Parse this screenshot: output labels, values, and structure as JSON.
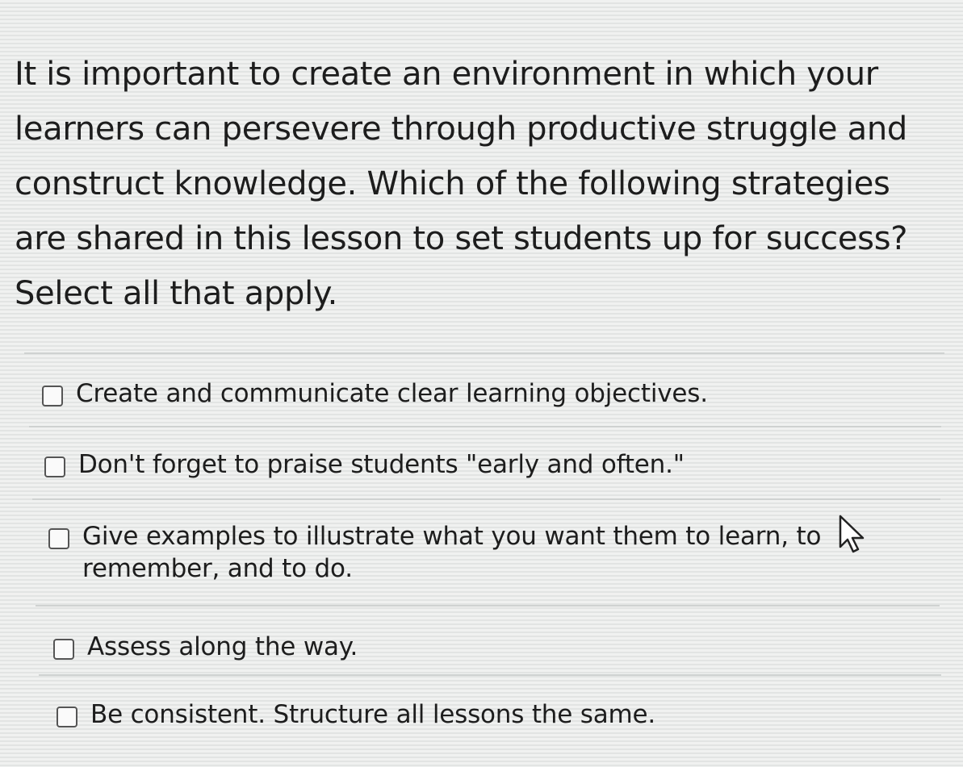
{
  "question": {
    "text": "It is important to create an environment in which your learners can persevere through productive struggle and construct knowledge. Which of the following strategies are shared in this lesson to set students up for success? Select all that apply."
  },
  "options": [
    {
      "label": "Create and communicate clear learning objectives.",
      "checked": false
    },
    {
      "label": "Don't forget to praise students \"early and often.\"",
      "checked": false
    },
    {
      "label": "Give examples to illustrate what you want them to learn, to remember, and to do.",
      "checked": false
    },
    {
      "label": "Assess along the way.",
      "checked": false
    },
    {
      "label": "Be consistent. Structure all lessons the same.",
      "checked": false
    }
  ],
  "icons": {
    "cursor": "mouse-pointer-icon"
  }
}
